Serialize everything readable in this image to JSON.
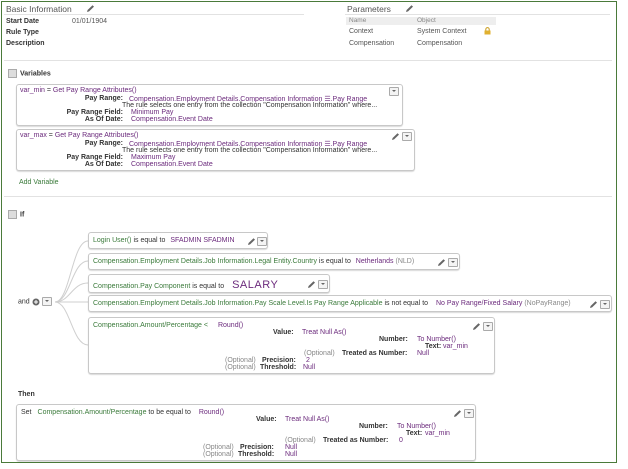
{
  "basic_info": {
    "title": "Basic Information",
    "start_date_label": "Start Date",
    "start_date_value": "01/01/1904",
    "rule_type_label": "Rule Type",
    "description_label": "Description"
  },
  "parameters": {
    "title": "Parameters",
    "col_name": "Name",
    "col_object": "Object",
    "rows": [
      {
        "name": "Context",
        "object": "System Context"
      },
      {
        "name": "Compensation",
        "object": "Compensation"
      }
    ]
  },
  "variables": {
    "title": "Variables",
    "items": [
      {
        "header_name": "var_min",
        "header_eq": " = ",
        "header_func": "Get Pay Range Attributes()",
        "pay_range_label": "Pay Range:",
        "pay_range_value": "Compensation.Employment Details.Compensation Information ☰.Pay Range",
        "desc": "The rule selects one entry from the collection \"Compensation Information\" where...",
        "field_label": "Pay Range Field:",
        "field_value": "Minimum Pay",
        "asof_label": "As Of Date:",
        "asof_value": "Compensation.Event Date"
      },
      {
        "header_name": "var_max",
        "header_eq": " = ",
        "header_func": "Get Pay Range Attributes()",
        "pay_range_label": "Pay Range:",
        "pay_range_value": "Compensation.Employment Details.Compensation Information ☰.Pay Range",
        "desc": "The rule selects one entry from the collection \"Compensation Information\" where...",
        "field_label": "Pay Range Field:",
        "field_value": "Maximum Pay",
        "asof_label": "As Of Date:",
        "asof_value": "Compensation.Event Date"
      }
    ],
    "add_label": "Add Variable"
  },
  "if_section": {
    "title": "If",
    "and_label": "and",
    "cond1": {
      "left": "Login User()",
      "op": " is equal to ",
      "right": "SFADMIN SFADMIN"
    },
    "cond2": {
      "left": "Compensation.Employment Details.Job Information.Legal Entity.Country",
      "op": " is equal to ",
      "right": "Netherlands",
      "right_extra": " (NLD)"
    },
    "cond3": {
      "left": "Compensation.Pay Component",
      "op": " is equal to ",
      "right": "SALARY"
    },
    "cond4": {
      "left": "Compensation.Employment Details.Job Information.Pay Scale Level.Is Pay Range Applicable",
      "op": " is not equal to ",
      "right": "No Pay Range/Fixed Salary",
      "right_extra": " (NoPayRange)"
    },
    "cond5": {
      "left": "Compensation.Amount/Percentage",
      "op": " < ",
      "func": "Round()",
      "value_label": "Value:",
      "value_func": "Treat Null As()",
      "number_label": "Number:",
      "number_func": "To Number()",
      "text_label": "Text:",
      "text_value": "var_min",
      "optional": "(Optional)",
      "treated_label": "Treated as Number:",
      "treated_value": "Null",
      "precision_label": "Precision:",
      "precision_value": "2",
      "threshold_label": "Threshold:",
      "threshold_value": "Null"
    }
  },
  "then_section": {
    "title": "Then",
    "set_label": "Set",
    "target": "Compensation.Amount/Percentage",
    "op": " to be equal to ",
    "func": "Round()",
    "value_label": "Value:",
    "value_func": "Treat Null As()",
    "number_label": "Number:",
    "number_func": "To Number()",
    "text_label": "Text:",
    "text_value": "var_min",
    "optional": "(Optional)",
    "treated_label": "Treated as Number:",
    "treated_value": "0",
    "precision_label": "Precision:",
    "precision_value": "Null",
    "threshold_label": "Threshold:",
    "threshold_value": "Null"
  }
}
